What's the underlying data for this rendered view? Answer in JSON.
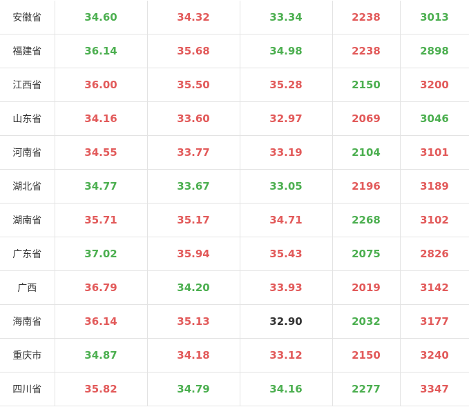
{
  "colors": {
    "red": "#e25a5a",
    "green": "#4caf50",
    "black": "#333333"
  },
  "rows": [
    {
      "region": "安徽省",
      "cells": [
        {
          "v": "34.60",
          "c": "green"
        },
        {
          "v": "34.32",
          "c": "red"
        },
        {
          "v": "33.34",
          "c": "green"
        },
        {
          "v": "2238",
          "c": "red"
        },
        {
          "v": "3013",
          "c": "green"
        }
      ]
    },
    {
      "region": "福建省",
      "cells": [
        {
          "v": "36.14",
          "c": "green"
        },
        {
          "v": "35.68",
          "c": "red"
        },
        {
          "v": "34.98",
          "c": "green"
        },
        {
          "v": "2238",
          "c": "red"
        },
        {
          "v": "2898",
          "c": "green"
        }
      ]
    },
    {
      "region": "江西省",
      "cells": [
        {
          "v": "36.00",
          "c": "red"
        },
        {
          "v": "35.50",
          "c": "red"
        },
        {
          "v": "35.28",
          "c": "red"
        },
        {
          "v": "2150",
          "c": "green"
        },
        {
          "v": "3200",
          "c": "red"
        }
      ]
    },
    {
      "region": "山东省",
      "cells": [
        {
          "v": "34.16",
          "c": "red"
        },
        {
          "v": "33.60",
          "c": "red"
        },
        {
          "v": "32.97",
          "c": "red"
        },
        {
          "v": "2069",
          "c": "red"
        },
        {
          "v": "3046",
          "c": "green"
        }
      ]
    },
    {
      "region": "河南省",
      "cells": [
        {
          "v": "34.55",
          "c": "red"
        },
        {
          "v": "33.77",
          "c": "red"
        },
        {
          "v": "33.19",
          "c": "red"
        },
        {
          "v": "2104",
          "c": "green"
        },
        {
          "v": "3101",
          "c": "red"
        }
      ]
    },
    {
      "region": "湖北省",
      "cells": [
        {
          "v": "34.77",
          "c": "green"
        },
        {
          "v": "33.67",
          "c": "green"
        },
        {
          "v": "33.05",
          "c": "green"
        },
        {
          "v": "2196",
          "c": "red"
        },
        {
          "v": "3189",
          "c": "red"
        }
      ]
    },
    {
      "region": "湖南省",
      "cells": [
        {
          "v": "35.71",
          "c": "red"
        },
        {
          "v": "35.17",
          "c": "red"
        },
        {
          "v": "34.71",
          "c": "red"
        },
        {
          "v": "2268",
          "c": "green"
        },
        {
          "v": "3102",
          "c": "red"
        }
      ]
    },
    {
      "region": "广东省",
      "cells": [
        {
          "v": "37.02",
          "c": "green"
        },
        {
          "v": "35.94",
          "c": "red"
        },
        {
          "v": "35.43",
          "c": "red"
        },
        {
          "v": "2075",
          "c": "green"
        },
        {
          "v": "2826",
          "c": "red"
        }
      ]
    },
    {
      "region": "广西",
      "cells": [
        {
          "v": "36.79",
          "c": "red"
        },
        {
          "v": "34.20",
          "c": "green"
        },
        {
          "v": "33.93",
          "c": "red"
        },
        {
          "v": "2019",
          "c": "red"
        },
        {
          "v": "3142",
          "c": "red"
        }
      ]
    },
    {
      "region": "海南省",
      "cells": [
        {
          "v": "36.14",
          "c": "red"
        },
        {
          "v": "35.13",
          "c": "red"
        },
        {
          "v": "32.90",
          "c": "black"
        },
        {
          "v": "2032",
          "c": "green"
        },
        {
          "v": "3177",
          "c": "red"
        }
      ]
    },
    {
      "region": "重庆市",
      "cells": [
        {
          "v": "34.87",
          "c": "green"
        },
        {
          "v": "34.18",
          "c": "red"
        },
        {
          "v": "33.12",
          "c": "red"
        },
        {
          "v": "2150",
          "c": "red"
        },
        {
          "v": "3240",
          "c": "red"
        }
      ]
    },
    {
      "region": "四川省",
      "cells": [
        {
          "v": "35.82",
          "c": "red"
        },
        {
          "v": "34.79",
          "c": "green"
        },
        {
          "v": "34.16",
          "c": "green"
        },
        {
          "v": "2277",
          "c": "green"
        },
        {
          "v": "3347",
          "c": "red"
        }
      ]
    }
  ]
}
